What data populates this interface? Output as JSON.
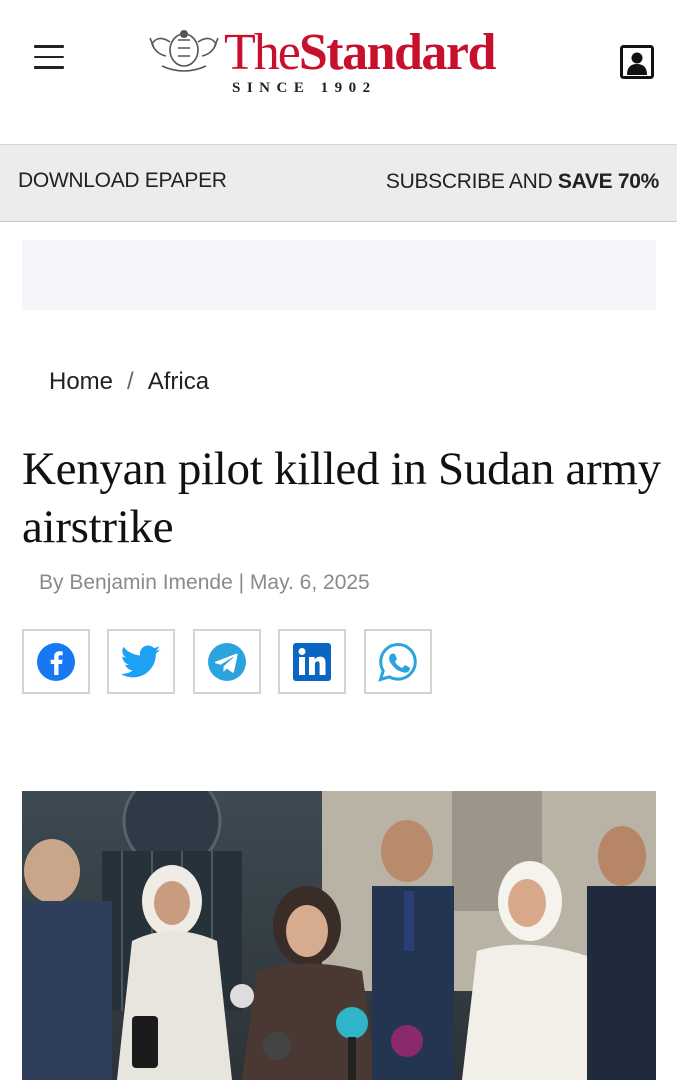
{
  "header": {
    "logo_title_the": "The",
    "logo_title_standard": "Standard",
    "logo_subtitle": "SINCE 1902",
    "menu_icon": "hamburger-menu-icon",
    "profile_icon": "user-account-icon",
    "brand_color": "#c8102e"
  },
  "subbar": {
    "epaper_label": "DOWNLOAD EPAPER",
    "subscribe_prefix": "SUBSCRIBE AND ",
    "subscribe_bold": "SAVE 70%"
  },
  "breadcrumb": {
    "home": "Home",
    "separator": "/",
    "section": "Africa"
  },
  "article": {
    "headline": "Kenyan pilot killed in Sudan army airstrike",
    "byline": "By Benjamin Imende | May. 6, 2025"
  },
  "share": [
    {
      "name": "facebook",
      "icon": "facebook-icon",
      "color": "#1877f2"
    },
    {
      "name": "twitter",
      "icon": "twitter-icon",
      "color": "#1da1f2"
    },
    {
      "name": "telegram",
      "icon": "telegram-icon",
      "color": "#2aa3df"
    },
    {
      "name": "linkedin",
      "icon": "linkedin-icon",
      "color": "#0a66c2"
    },
    {
      "name": "whatsapp",
      "icon": "whatsapp-icon",
      "color": "#2aa3df"
    }
  ],
  "photo": {
    "description_icon": "article-photo"
  }
}
